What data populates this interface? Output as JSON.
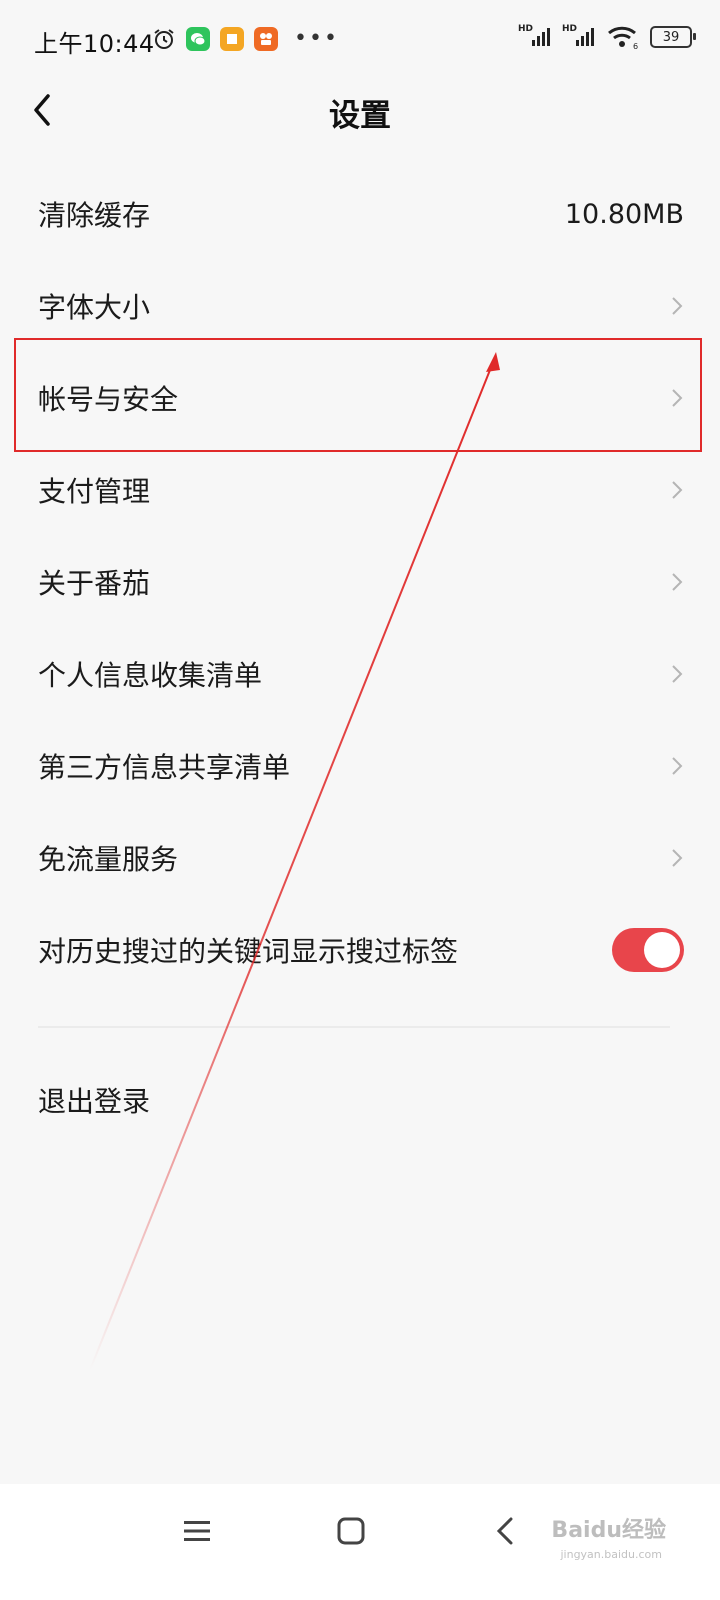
{
  "status_bar": {
    "time": "上午10:44",
    "battery": "39",
    "signal_label": "HD",
    "wifi_label": "6"
  },
  "header": {
    "title": "设置"
  },
  "settings": {
    "items": [
      {
        "label": "清除缓存",
        "value": "10.80MB"
      },
      {
        "label": "字体大小"
      },
      {
        "label": "帐号与安全"
      },
      {
        "label": "支付管理"
      },
      {
        "label": "关于番茄"
      },
      {
        "label": "个人信息收集清单"
      },
      {
        "label": "第三方信息共享清单"
      },
      {
        "label": "免流量服务"
      },
      {
        "label": "对历史搜过的关键词显示搜过标签",
        "toggle_on": true
      }
    ],
    "logout_label": "退出登录"
  },
  "watermark": {
    "text": "Baidu经验",
    "sub": "jingyan.baidu.com"
  },
  "colors": {
    "toggle_on": "#e8454b",
    "highlight": "#e02a2a",
    "background": "#f7f7f7"
  }
}
